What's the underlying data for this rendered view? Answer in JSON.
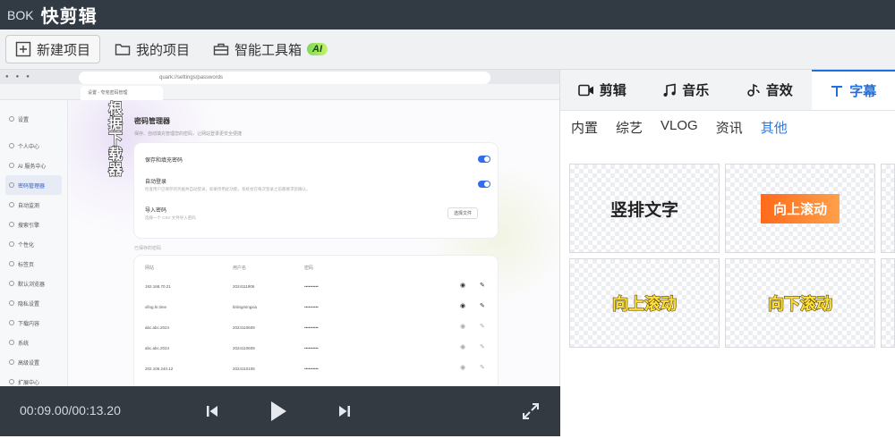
{
  "app": {
    "logo_mark": "BOK",
    "title": "快剪辑"
  },
  "toolbar": {
    "new_project": "新建项目",
    "my_projects": "我的项目",
    "toolbox": "智能工具箱",
    "ai_badge": "AI"
  },
  "preview": {
    "overlay_text": "根据下载器",
    "screen": {
      "url": "quark://settings/passwords",
      "tab_label": "设置 - 夸克密码管理",
      "page_title": "密码管理器",
      "page_subtitle": "保存、自动填充管理您的密码，让网站登录更安全便捷",
      "sidebar": [
        "设置",
        "个人中心",
        "AI 服务中心",
        "密码管理器",
        "自动监测",
        "搜索引擎",
        "个性化",
        "标签页",
        "默认浏览器",
        "隐私设置",
        "下载内容",
        "系统",
        "高级设置",
        "扩展中心"
      ],
      "row1_label": "保存和填充密码",
      "row2_label": "自动登录",
      "row2_sub": "检查用户已保存的凭据并自动登录，如果停用此功能，系统会在每次登录之前都要求您确认。",
      "row3_label": "导入密码",
      "row3_sub": "选择一个 CSV 文件导入密码",
      "row3_button": "选择文件",
      "table_caption": "已保存的密码",
      "table_headers": [
        "网站",
        "用户名",
        "密码"
      ],
      "table_rows": [
        [
          "192.168.70.21",
          "2024111906",
          "••••••••••"
        ],
        [
          "xfing.hi.time",
          "linlingmingxia",
          "••••••••••"
        ],
        [
          "abc.abc.2024",
          "2024110609",
          "••••••••••"
        ],
        [
          "abc.abc.2024",
          "2024110609",
          "••••••••••"
        ],
        [
          "202.106.240.12",
          "2024110106",
          "••••••••••"
        ]
      ]
    }
  },
  "player": {
    "timecode": "00:09.00/00:13.20"
  },
  "right_panel": {
    "tabs": [
      {
        "label": "剪辑",
        "icon": "video-icon"
      },
      {
        "label": "音乐",
        "icon": "music-icon"
      },
      {
        "label": "音效",
        "icon": "sound-effect-icon"
      },
      {
        "label": "字幕",
        "icon": "text-icon"
      }
    ],
    "active_tab": "字幕",
    "subtabs": [
      "内置",
      "综艺",
      "VLOG",
      "资讯",
      "其他"
    ],
    "active_subtab": "其他",
    "templates": [
      "竖排文字",
      "向上滚动",
      "向上滚动",
      "向下滚动"
    ]
  },
  "colors": {
    "accent": "#1e6fe0",
    "titlebar": "#323a44",
    "player": "#343a42",
    "orange": "#ff7a22",
    "yellow": "#ffe13a"
  }
}
